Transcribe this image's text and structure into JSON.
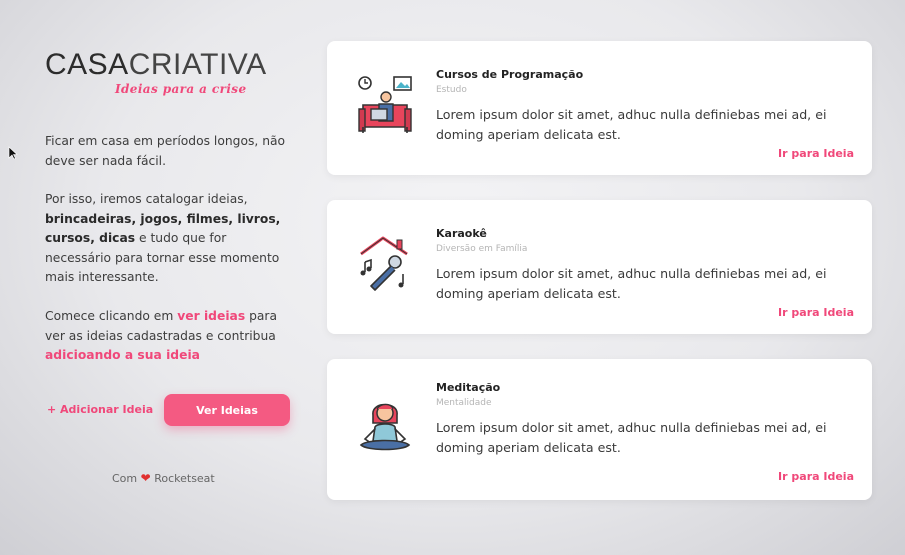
{
  "brand": {
    "logo_part_1": "CASA",
    "logo_part_2": "CRIATIVA",
    "tagline": "Ideias para a crise"
  },
  "intro": {
    "p1": "Ficar em casa em períodos longos, não deve ser nada fácil.",
    "p2_start": "Por isso, iremos catalogar ideias, ",
    "p2_bold": "brincadeiras, jogos, filmes, livros, cursos, dicas",
    "p2_end": " e tudo que for necessário para tornar esse momento mais interessante.",
    "p3_a": "Comece clicando em ",
    "p3_link1": "ver ideias",
    "p3_b": " para ver as  ideias cadastradas e contribua ",
    "p3_link2": "adicioando a sua ideia"
  },
  "actions": {
    "add_label": "+ Adicionar Ideia",
    "view_label": "Ver Ideias"
  },
  "footer": {
    "prefix": "Com",
    "suffix": "Rocketseat"
  },
  "colors": {
    "accent": "#f0487a",
    "button": "#f45a82"
  },
  "ideas": [
    {
      "title": "Cursos de Programação",
      "category": "Estudo",
      "description": "Lorem ipsum dolor sit amet, adhuc nulla definiebas mei ad, ei doming aperiam delicata est.",
      "link": "Ir para Ideia",
      "icon": "programming-course-icon"
    },
    {
      "title": "Karaokê",
      "category": "Diversão em Família",
      "description": "Lorem ipsum dolor sit amet, adhuc nulla definiebas mei ad, ei doming aperiam delicata est.",
      "link": "Ir para Ideia",
      "icon": "karaoke-icon"
    },
    {
      "title": "Meditação",
      "category": "Mentalidade",
      "description": "Lorem ipsum dolor sit amet, adhuc nulla definiebas mei ad, ei doming aperiam delicata est.",
      "link": "Ir para Ideia",
      "icon": "meditation-icon"
    }
  ]
}
